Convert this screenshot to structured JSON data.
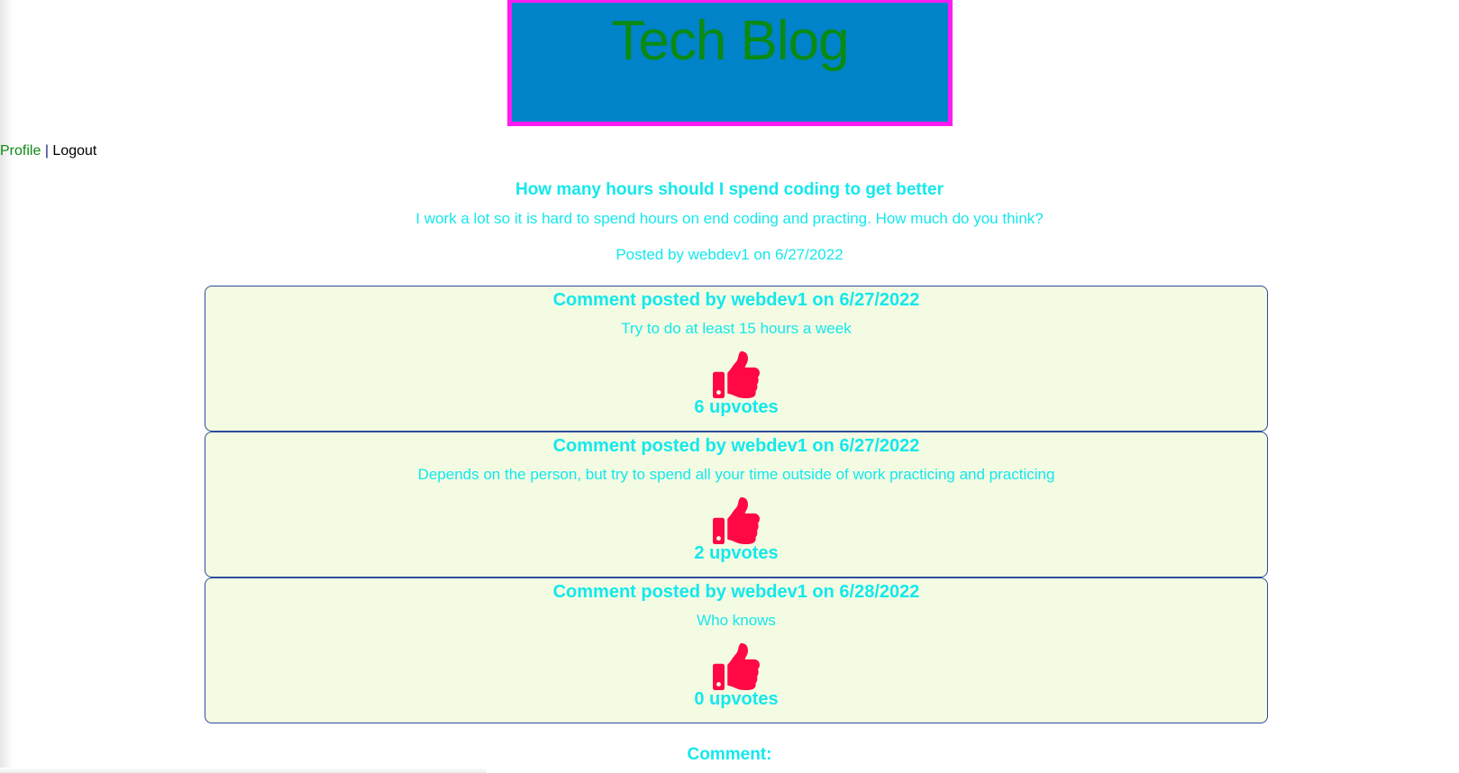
{
  "header": {
    "title": "Tech Blog"
  },
  "nav": {
    "profile": "Profile",
    "separator": "|",
    "logout": "Logout"
  },
  "post": {
    "title": "How many hours should I spend coding to get better",
    "body": "I work a lot so it is hard to spend hours on end coding and practing. How much do you think?",
    "meta": "Posted by webdev1 on 6/27/2022"
  },
  "comments": [
    {
      "header": "Comment posted by webdev1 on 6/27/2022",
      "text": "Try to do at least 15 hours a week",
      "upvotes": "6 upvotes",
      "icon": "thumbs-up-icon"
    },
    {
      "header": "Comment posted by webdev1 on 6/27/2022",
      "text": "Depends on the person, but try to spend all your time outside of work practicing and practicing",
      "upvotes": "2 upvotes",
      "icon": "thumbs-up-icon"
    },
    {
      "header": "Comment posted by webdev1 on 6/28/2022",
      "text": "Who knows",
      "upvotes": "0 upvotes",
      "icon": "thumbs-up-icon"
    }
  ],
  "comment_form": {
    "label": "Comment:"
  },
  "colors": {
    "header_bg": "#0083c9",
    "header_border": "#ff1cf3",
    "title_text": "#0a8a12",
    "content_text": "#14e8ec",
    "comment_bg": "#f3fbe2",
    "comment_border": "#2b4c9b",
    "thumb_icon": "#ff0844"
  }
}
